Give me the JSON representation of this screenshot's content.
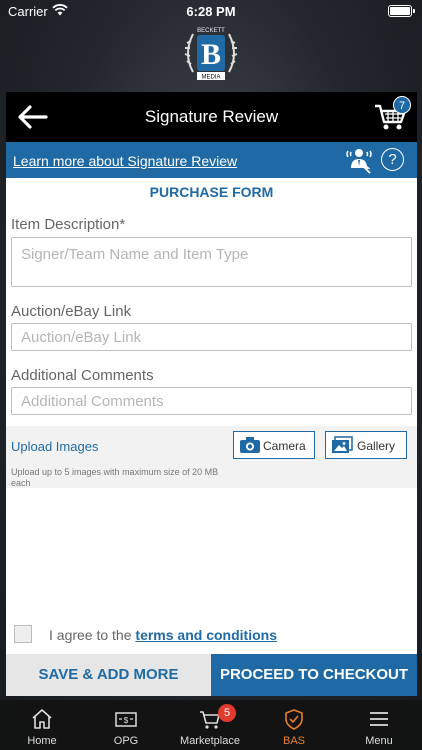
{
  "status_bar": {
    "carrier": "Carrier",
    "time": "6:28 PM"
  },
  "logo": {
    "top_text": "BECKETT",
    "letter": "B",
    "bottom_text": "MEDIA"
  },
  "header": {
    "title": "Signature Review",
    "cart_count": "7"
  },
  "info_bar": {
    "learn_more": "Learn more about Signature Review",
    "help": "?"
  },
  "form": {
    "title": "PURCHASE FORM",
    "item_description": {
      "label": "Item Description*",
      "placeholder": "Signer/Team Name and Item Type"
    },
    "auction_link": {
      "label": "Auction/eBay Link",
      "placeholder": "Auction/eBay Link"
    },
    "comments": {
      "label": "Additional Comments",
      "placeholder": "Additional Comments"
    }
  },
  "upload": {
    "title": "Upload Images",
    "note": "Upload up to 5 images with maximum size of 20 MB each",
    "camera": "Camera",
    "gallery": "Gallery"
  },
  "agree": {
    "prefix": "I agree to the ",
    "link": "terms and conditions"
  },
  "actions": {
    "save": "SAVE & ADD MORE",
    "checkout": "PROCEED TO CHECKOUT"
  },
  "tabs": [
    {
      "label": "Home",
      "icon": "home-icon"
    },
    {
      "label": "OPG",
      "icon": "price-guide-icon"
    },
    {
      "label": "Marketplace",
      "icon": "cart-icon",
      "badge": "5"
    },
    {
      "label": "BAS",
      "icon": "shield-icon"
    },
    {
      "label": "Menu",
      "icon": "menu-icon"
    }
  ],
  "colors": {
    "primary": "#1f6aa5",
    "active_tab": "#e8802a",
    "badge_red": "#e03a2f"
  }
}
